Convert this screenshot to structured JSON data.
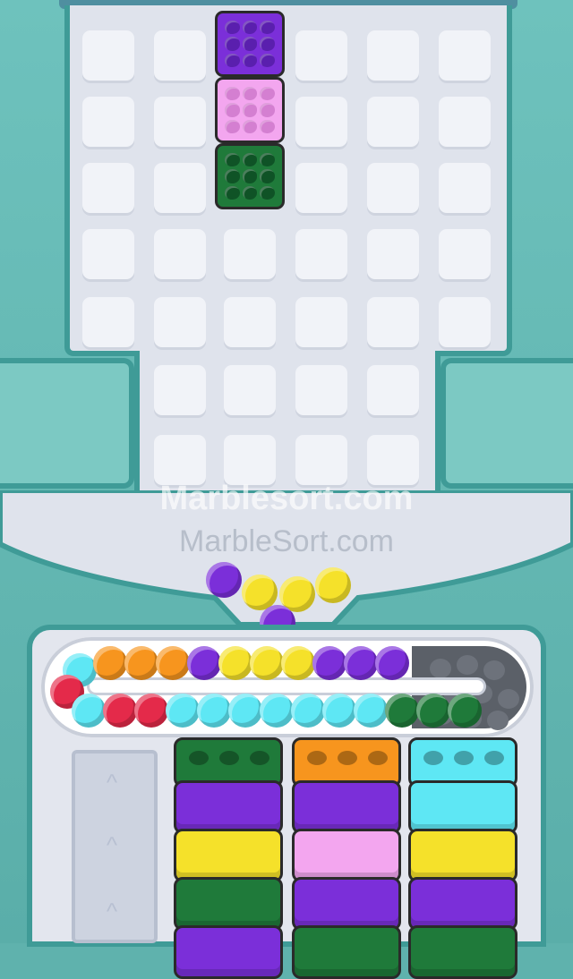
{
  "watermarks": {
    "primary": "Marblesort.com",
    "secondary": "MarbleSort.com"
  },
  "colors": {
    "purple": "#7b2fd9",
    "pink": "#f3a6ef",
    "green": "#1f7a3a",
    "yellow": "#f5e12a",
    "orange": "#f7951e",
    "cyan": "#5ee7f4",
    "red": "#e42a4a",
    "teal_frame": "#3f9b97"
  },
  "board": {
    "rows": [
      [
        "empty",
        "empty",
        "purple",
        "empty",
        "empty",
        "empty"
      ],
      [
        "empty",
        "empty",
        "pink",
        "empty",
        "empty",
        "empty"
      ],
      [
        "empty",
        "empty",
        "green",
        "empty",
        "empty",
        "empty"
      ],
      [
        "empty",
        "empty",
        "empty",
        "empty",
        "empty",
        "empty"
      ],
      [
        "empty",
        "empty",
        "empty",
        "empty",
        "empty",
        "empty"
      ],
      [
        "none",
        "empty",
        "empty",
        "empty",
        "empty",
        "none"
      ],
      [
        "none",
        "empty",
        "empty",
        "empty",
        "empty",
        "none"
      ]
    ]
  },
  "falling_marbles": [
    "purple",
    "yellow",
    "yellow",
    "yellow",
    "purple"
  ],
  "conveyor": {
    "top_row": [
      "cyan",
      "orange",
      "orange",
      "orange",
      "purple",
      "yellow",
      "yellow",
      "yellow",
      "purple",
      "purple",
      "purple"
    ],
    "bottom_row": [
      "cyan",
      "red",
      "red",
      "cyan",
      "cyan",
      "cyan",
      "cyan",
      "cyan",
      "cyan",
      "cyan",
      "green",
      "green",
      "green"
    ],
    "left_end": [
      "red"
    ]
  },
  "stacks": [
    {
      "lid": "green",
      "layers": [
        "purple",
        "yellow",
        "green",
        "purple"
      ]
    },
    {
      "lid": "orange",
      "layers": [
        "purple",
        "pink",
        "purple",
        "green"
      ]
    },
    {
      "lid": "cyan",
      "layers": [
        "cyan",
        "yellow",
        "purple",
        "green"
      ]
    }
  ]
}
